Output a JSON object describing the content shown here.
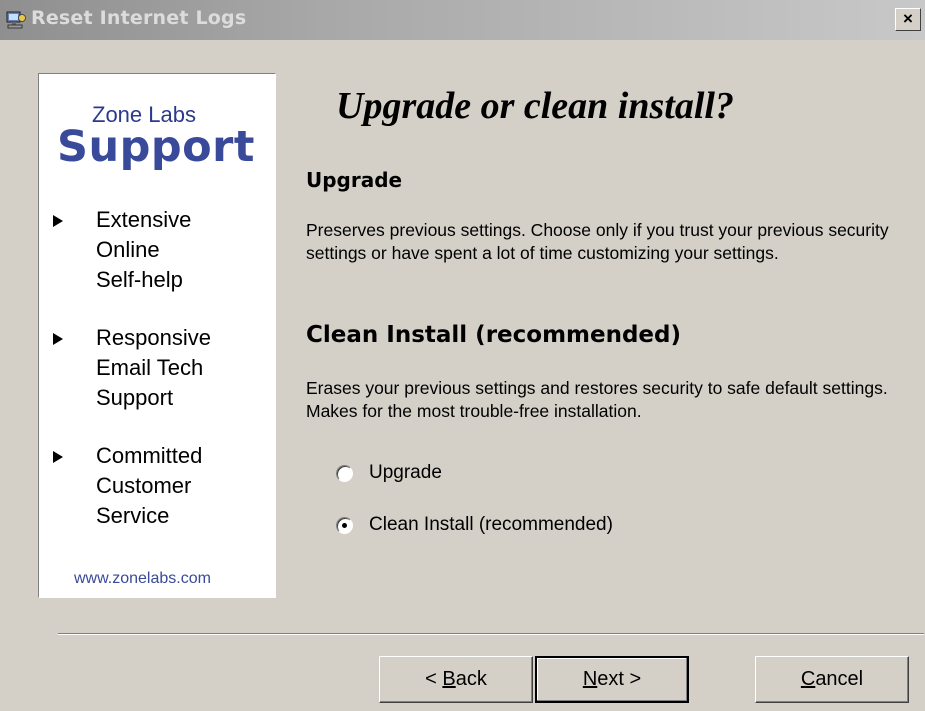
{
  "window": {
    "title": "Reset Internet Logs",
    "close_label": "×"
  },
  "sidebar": {
    "brand_small": "Zone Labs",
    "brand_big": "Support",
    "features": [
      {
        "text": "Extensive\nOnline\nSelf-help"
      },
      {
        "text": "Responsive\nEmail Tech\nSupport"
      },
      {
        "text": "Committed\nCustomer\nService"
      }
    ],
    "website": "www.zonelabs.com"
  },
  "main": {
    "heading": "Upgrade or clean install?",
    "upgrade_title": "Upgrade",
    "upgrade_desc": "Preserves previous settings. Choose only if you trust your previous security settings or have spent a lot of time customizing your settings.",
    "clean_title": "Clean Install (recommended)",
    "clean_desc": "Erases your previous settings and restores security to safe default settings.  Makes for the most trouble-free installation.",
    "options": [
      {
        "label": "Upgrade",
        "checked": false
      },
      {
        "label": "Clean Install (recommended)",
        "checked": true
      }
    ]
  },
  "buttons": {
    "back": {
      "prefix": "< ",
      "accel": "B",
      "rest": "ack"
    },
    "next": {
      "prefix": "",
      "accel": "N",
      "rest": "ext >"
    },
    "cancel": {
      "prefix": "",
      "accel": "C",
      "rest": "ancel"
    }
  }
}
